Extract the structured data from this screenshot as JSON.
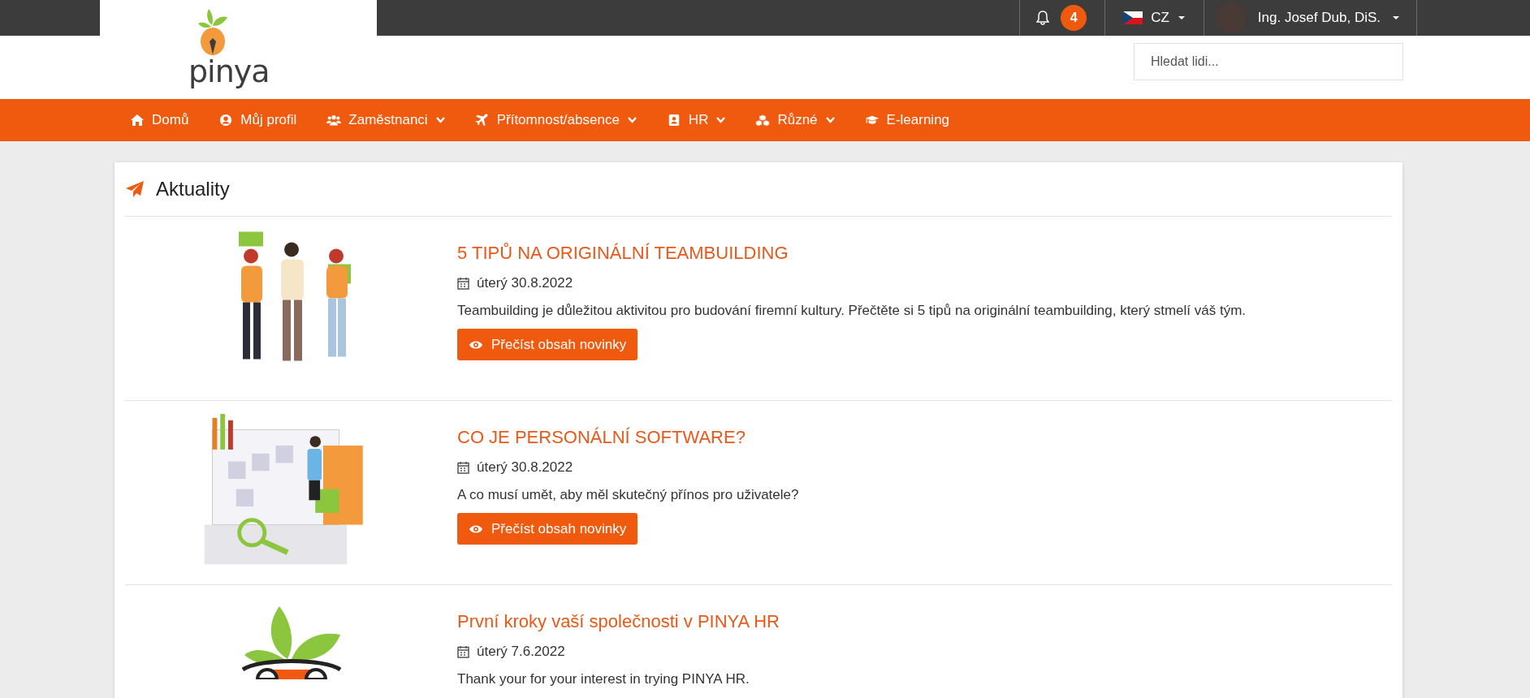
{
  "topbar": {
    "notifications": {
      "count": "4"
    },
    "language": {
      "label": "CZ"
    },
    "user": {
      "name": "Ing. Josef Dub, DiS."
    }
  },
  "header": {
    "logo": "pinya",
    "search": {
      "placeholder": "Hledat lidi..."
    }
  },
  "nav": [
    {
      "label": "Domů",
      "dropdown": false
    },
    {
      "label": "Můj profil",
      "dropdown": false
    },
    {
      "label": "Zaměstnanci",
      "dropdown": true
    },
    {
      "label": "Přítomnost/absence",
      "dropdown": true
    },
    {
      "label": "HR",
      "dropdown": true
    },
    {
      "label": "Různé",
      "dropdown": true
    },
    {
      "label": "E-learning",
      "dropdown": false
    }
  ],
  "news": {
    "title": "Aktuality",
    "articles": [
      {
        "title": "5 TIPŮ NA ORIGINÁLNÍ TEAMBUILDING",
        "date": "úterý 30.8.2022",
        "text": "Teambuilding je důležitou aktivitou pro budování firemní kultury. Přečtěte si 5 tipů na originální teambuilding, který stmelí váš tým.",
        "button": "Přečíst obsah novinky"
      },
      {
        "title": "CO JE PERSONÁLNÍ SOFTWARE?",
        "date": "úterý 30.8.2022",
        "text": "A co musí umět, aby měl skutečný přínos pro uživatele?",
        "button": "Přečíst obsah novinky"
      },
      {
        "title": "První kroky vaší společnosti v PINYA HR",
        "date": "úterý 7.6.2022",
        "text": "Thank your for your interest in trying PINYA HR."
      }
    ]
  }
}
